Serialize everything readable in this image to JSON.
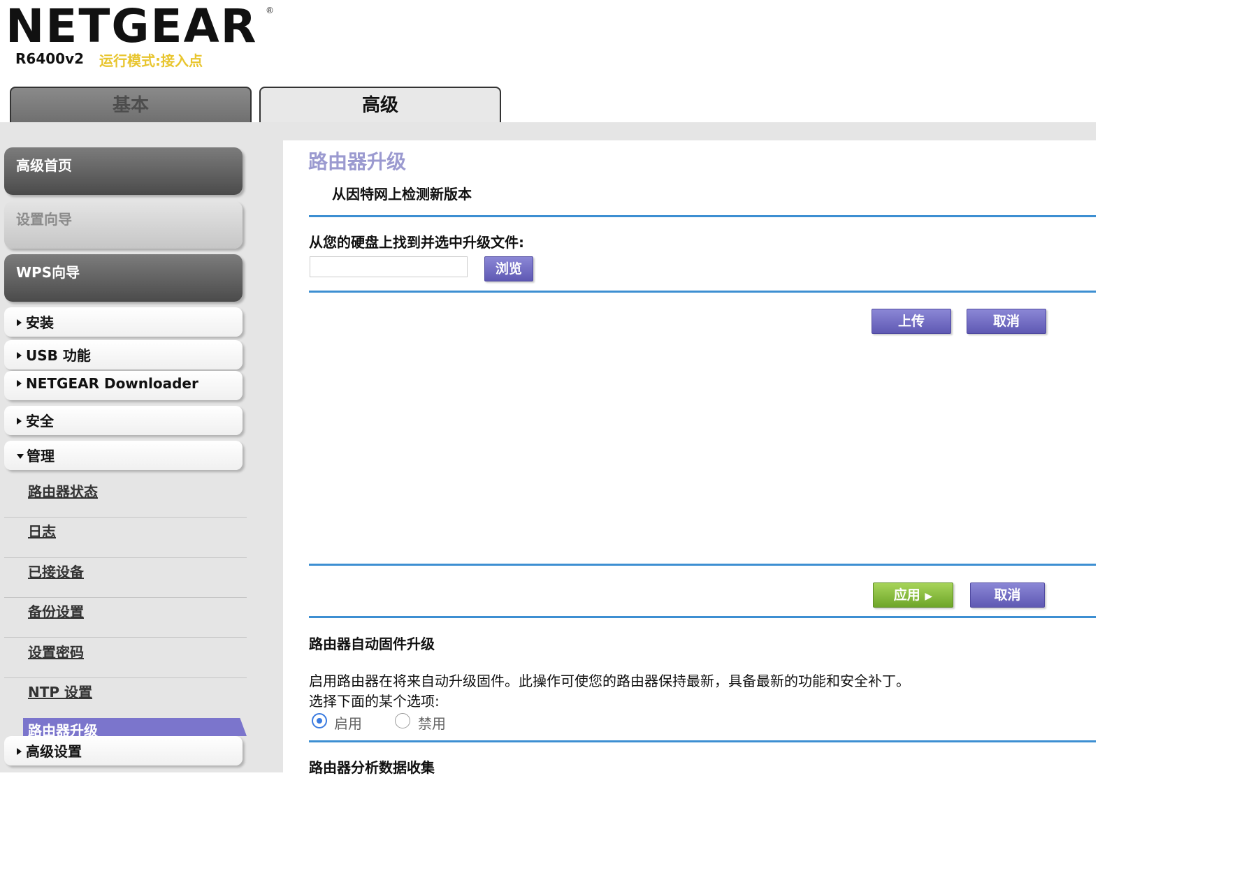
{
  "header": {
    "brand": "NETGEAR",
    "registered": "®",
    "model": "R6400v2",
    "mode": "运行模式:接入点"
  },
  "tabs": [
    {
      "label": "基本",
      "active": false
    },
    {
      "label": "高级",
      "active": true
    }
  ],
  "sidebar": {
    "home": "高级首页",
    "setup_wizard": "设置向导",
    "wps_wizard": "WPS向导",
    "menus": [
      {
        "label": "安装",
        "expanded": false
      },
      {
        "label": "USB 功能",
        "expanded": false
      },
      {
        "label": "NETGEAR Downloader",
        "expanded": false
      },
      {
        "label": "安全",
        "expanded": false
      },
      {
        "label": "管理",
        "expanded": true
      }
    ],
    "admin_items": [
      "路由器状态",
      "日志",
      "已接设备",
      "备份设置",
      "设置密码",
      "NTP 设置",
      "路由器升级"
    ],
    "active_item": "路由器升级",
    "advanced_setup": "高级设置"
  },
  "main": {
    "title": "路由器升级",
    "check_online": "从因特网上检测新版本",
    "file_label": "从您的硬盘上找到并选中升级文件:",
    "file_value": "",
    "browse": "浏览",
    "upload": "上传",
    "cancel": "取消",
    "apply": "应用",
    "auto_title": "路由器自动固件升级",
    "auto_desc": "启用路由器在将来自动升级固件。此操作可使您的路由器保持最新，具备最新的功能和安全补丁。",
    "select_prompt": "选择下面的某个选项:",
    "enable": "启用",
    "disable": "禁用",
    "auto_upgrade_selected": "启用",
    "analytics_title": "路由器分析数据收集"
  },
  "colors": {
    "accent": "#7b75cc",
    "mode_text": "#e8c52e",
    "divider": "#3d8fd2",
    "apply_green": "#8bc043",
    "title": "#9b9ad0"
  }
}
